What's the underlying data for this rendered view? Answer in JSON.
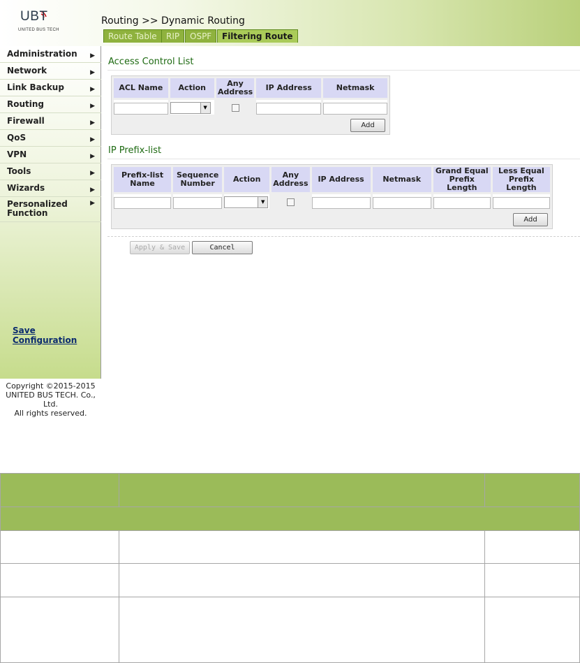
{
  "logo": {
    "brand": "UBT",
    "subtitle": "UNITED BUS TECH"
  },
  "breadcrumb": "Routing >> Dynamic Routing",
  "tabs": [
    {
      "label": "Route Table",
      "active": false
    },
    {
      "label": "RIP",
      "active": false
    },
    {
      "label": "OSPF",
      "active": false
    },
    {
      "label": "Filtering Route",
      "active": true
    }
  ],
  "sidebar": {
    "items": [
      {
        "label": "Administration"
      },
      {
        "label": "Network"
      },
      {
        "label": "Link Backup"
      },
      {
        "label": "Routing"
      },
      {
        "label": "Firewall"
      },
      {
        "label": "QoS"
      },
      {
        "label": "VPN"
      },
      {
        "label": "Tools"
      },
      {
        "label": "Wizards"
      },
      {
        "label": "Personalized Function"
      }
    ],
    "arrow": "▶",
    "save_label": "Save Configuration",
    "copyright": [
      "Copyright ©2015-2015",
      "UNITED BUS TECH. Co.,",
      "Ltd.",
      "All rights reserved."
    ]
  },
  "acl": {
    "title": "Access Control List",
    "headers": [
      "ACL Name",
      "Action",
      "Any Address",
      "IP Address",
      "Netmask"
    ],
    "add_label": "Add"
  },
  "prefix": {
    "title": "IP Prefix-list",
    "headers": [
      "Prefix-list Name",
      "Sequence Number",
      "Action",
      "Any Address",
      "IP Address",
      "Netmask",
      "Grand Equal Prefix Length",
      "Less Equal Prefix Length"
    ],
    "add_label": "Add"
  },
  "buttons": {
    "apply": "Apply & Save",
    "cancel": "Cancel"
  },
  "colors": {
    "accent_green": "#9bbb59",
    "tab_green": "#8fb23e",
    "header_purple": "#d8d8f4",
    "title_green": "#1e6a12"
  }
}
